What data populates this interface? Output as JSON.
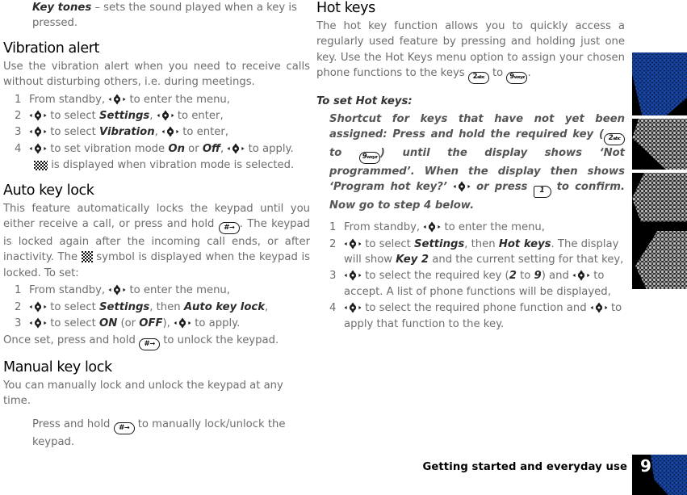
{
  "document": {
    "page_number": "9",
    "footer_text": "Getting started and everyday use"
  },
  "icons": {
    "nav": "navigation-joystick-icon",
    "key_2": "2",
    "key_2_sub": "abc",
    "key_9": "9",
    "key_9_sub": "wxyz",
    "key_hash": "#",
    "key_1": "1",
    "vibration_symbol": "vibration-mode-icon",
    "lock_symbol": "keypad-lock-icon"
  },
  "left_column": {
    "intro": {
      "term": "Key tones",
      "text": " – sets the sound played when a key is pressed."
    },
    "vibration_alert": {
      "heading": "Vibration alert",
      "body": "Use the vibration alert when you need to receive calls without disturbing others, i.e. during meetings.",
      "steps": [
        {
          "num": "1",
          "pre": "From standby, ",
          "mid": " to enter the menu,",
          "post": ""
        },
        {
          "num": "2",
          "pre": "",
          "mid": " to select ",
          "em": "Settings",
          "mid2": ", ",
          "post": " to enter,"
        },
        {
          "num": "3",
          "pre": "",
          "mid": " to select ",
          "em": "Vibration",
          "mid2": ", ",
          "post": " to enter,"
        },
        {
          "num": "4",
          "pre": "",
          "mid": " to set vibration mode ",
          "em": "On",
          "mid2": " or ",
          "em2": "Off",
          "mid3": ", ",
          "post": " to apply."
        }
      ],
      "note": " is displayed when vibration mode is selected."
    },
    "auto_key_lock": {
      "heading": "Auto key lock",
      "body_part1": "This feature automatically locks the keypad until you either receive a call, or press and hold ",
      "body_part2": ". The keypad is locked again after the incoming call ends, or after inactivity. The ",
      "body_part3": " symbol is displayed when the keypad is locked. To set:",
      "steps": [
        {
          "num": "1",
          "pre": "From standby, ",
          "mid": " to enter the menu,"
        },
        {
          "num": "2",
          "mid": " to select ",
          "em": "Settings",
          "mid2": ", then ",
          "em2": "Auto key lock",
          "post": ","
        },
        {
          "num": "3",
          "mid": " to select ",
          "em": "ON",
          "mid2": " (or ",
          "em2": "OFF",
          "mid3": "), ",
          "post": " to apply."
        }
      ],
      "closing_pre": "Once set, press and hold ",
      "closing_post": " to unlock the keypad."
    },
    "manual_key_lock": {
      "heading": "Manual key lock",
      "body": "You can manually lock and unlock the keypad at any time.",
      "instruction_pre": "Press and hold ",
      "instruction_post": " to manually lock/unlock the keypad."
    }
  },
  "right_column": {
    "hot_keys": {
      "heading": "Hot keys",
      "body_part1": "The hot key function allows you to quickly access a regularly used feature by pressing and holding just one key. Use the Hot Keys menu option to assign your chosen phone functions to the keys ",
      "body_mid": " to ",
      "body_part2": ".",
      "set_heading": "To set Hot keys:",
      "shortcut_p1": "Shortcut for keys that have not yet been assigned: Press and hold the required key (",
      "shortcut_p2": " to ",
      "shortcut_p3": ") until the display shows ‘Not programmed’. When the display then shows ‘Program hot key?’ ",
      "shortcut_p4": " or press ",
      "shortcut_p5": " to confirm. Now go to step 4 below.",
      "steps": [
        {
          "num": "1",
          "pre": "From standby, ",
          "mid": " to enter the menu,"
        },
        {
          "num": "2",
          "mid": " to select ",
          "em": "Settings",
          "mid2": ", then ",
          "em2": "Hot keys",
          "mid3": ". The display will show ",
          "em3": "Key 2",
          "post": " and the current setting for that key,"
        },
        {
          "num": "3",
          "mid": " to select the required key (",
          "em": "2",
          "mid2": " to ",
          "em2": "9",
          "mid3": ") and ",
          "post": " to accept. A list of phone functions will be displayed,"
        },
        {
          "num": "4",
          "mid": " to select the required phone function and ",
          "post": " to apply that function to the key."
        }
      ]
    }
  },
  "colors": {
    "body_text": "#6d6d6d",
    "heading_text": "#000000",
    "accent_blue": "#15409a",
    "deco_background": "#000000"
  }
}
